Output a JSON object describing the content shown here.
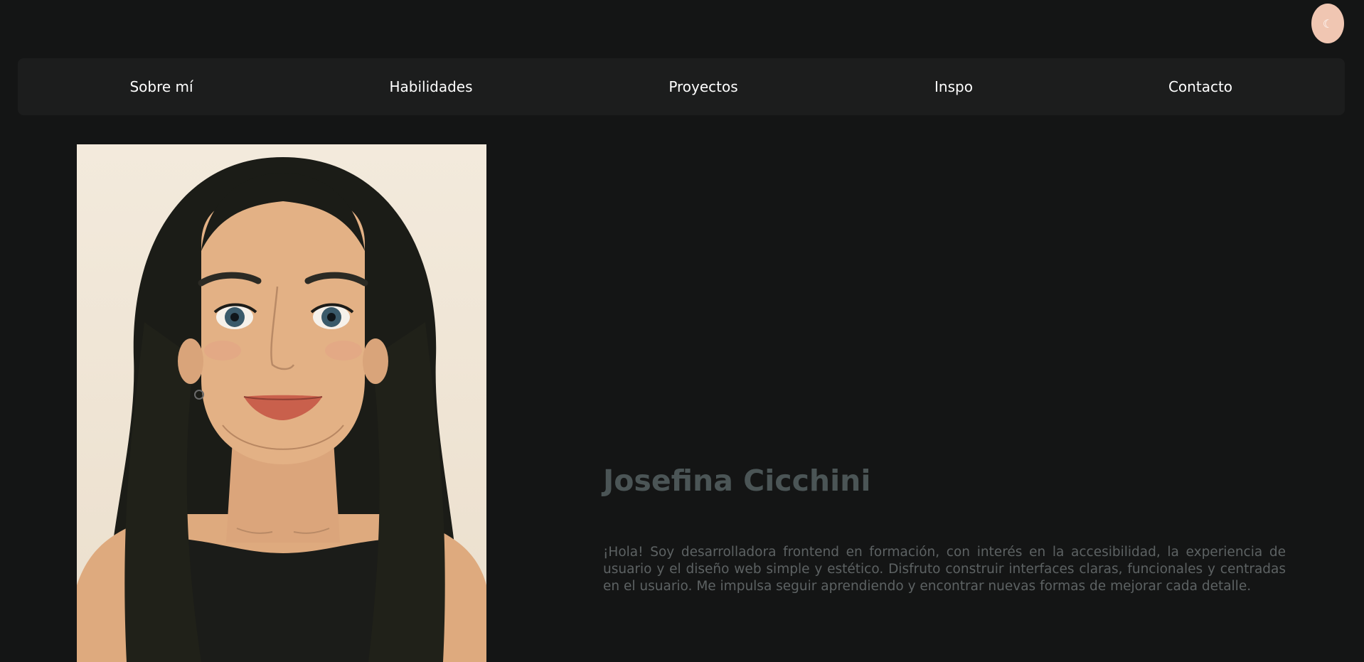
{
  "theme_toggle": {
    "icon": "moon-icon",
    "glyph": "☾"
  },
  "nav": {
    "items": [
      {
        "label": "Sobre mí"
      },
      {
        "label": "Habilidades"
      },
      {
        "label": "Proyectos"
      },
      {
        "label": "Inspo"
      },
      {
        "label": "Contacto"
      }
    ]
  },
  "hero": {
    "name": "Josefina Cicchini",
    "bio": "¡Hola! Soy desarrolladora frontend en formación, con interés en la accesibilidad, la experiencia de usuario y el diseño web simple y estético. Disfruto construir interfaces claras, funcionales y centradas en el usuario. Me impulsa seguir aprendiendo y encontrar nuevas formas de mejorar cada detalle."
  },
  "colors": {
    "background": "#141515",
    "navbar": "#1c1d1d",
    "accent": "#f0c6b2",
    "name_text": "#4b5556",
    "bio_text": "#5d6263"
  }
}
